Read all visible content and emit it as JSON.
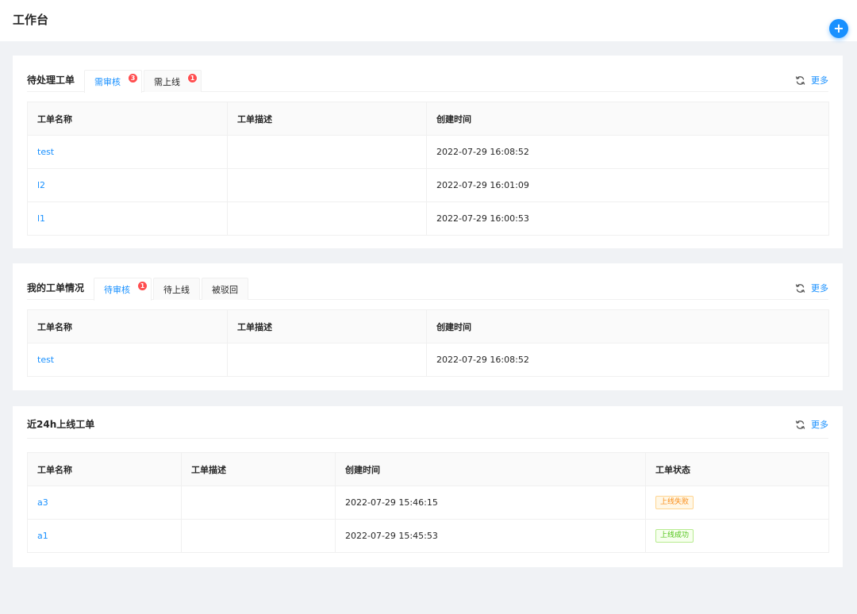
{
  "page": {
    "title": "工作台",
    "fab_label": "+"
  },
  "pending": {
    "title": "待处理工单",
    "tabs": [
      {
        "label": "需审核",
        "badge": "3",
        "active": true
      },
      {
        "label": "需上线",
        "badge": "1",
        "active": false
      }
    ],
    "more_label": "更多",
    "columns": [
      "工单名称",
      "工单描述",
      "创建时间"
    ],
    "rows": [
      {
        "name": "test",
        "desc": "",
        "created": "2022-07-29 16:08:52"
      },
      {
        "name": "l2",
        "desc": "",
        "created": "2022-07-29 16:01:09"
      },
      {
        "name": "l1",
        "desc": "",
        "created": "2022-07-29 16:00:53"
      }
    ]
  },
  "mine": {
    "title": "我的工单情况",
    "tabs": [
      {
        "label": "待审核",
        "badge": "1",
        "active": true
      },
      {
        "label": "待上线",
        "badge": "",
        "active": false
      },
      {
        "label": "被驳回",
        "badge": "",
        "active": false
      }
    ],
    "more_label": "更多",
    "columns": [
      "工单名称",
      "工单描述",
      "创建时间"
    ],
    "rows": [
      {
        "name": "test",
        "desc": "",
        "created": "2022-07-29 16:08:52"
      }
    ]
  },
  "recent": {
    "title": "近24h上线工单",
    "more_label": "更多",
    "columns": [
      "工单名称",
      "工单描述",
      "创建时间",
      "工单状态"
    ],
    "rows": [
      {
        "name": "a3",
        "desc": "",
        "created": "2022-07-29 15:46:15",
        "status": "上线失败",
        "status_color": "#fa8c16",
        "status_bg": "#fff7e6",
        "status_border": "#ffd591"
      },
      {
        "name": "a1",
        "desc": "",
        "created": "2022-07-29 15:45:53",
        "status": "上线成功",
        "status_color": "#52c41a",
        "status_bg": "#f6ffed",
        "status_border": "#b7eb8f"
      }
    ]
  },
  "colors": {
    "accent": "#1890ff",
    "badge": "#ff4d4f",
    "background": "#f0f2f5"
  },
  "icons": {
    "refresh": "refresh-icon",
    "add": "plus-icon"
  }
}
